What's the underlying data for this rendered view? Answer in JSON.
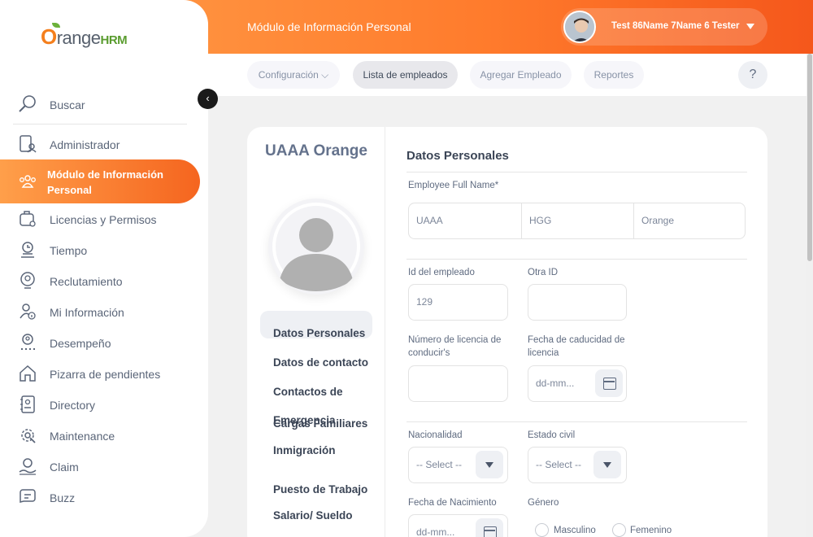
{
  "header": {
    "module_title": "Módulo de Información Personal",
    "user_name": "Test 86Name 7Name 6 Tester"
  },
  "logo": {
    "part1": "O",
    "part2": "range",
    "part3": "HRM"
  },
  "subnav": {
    "items": [
      "Configuración",
      "Lista de empleados",
      "Agregar Empleado",
      "Reportes"
    ],
    "help": "?"
  },
  "sidebar": {
    "items": [
      {
        "label": "Buscar",
        "icon": "search-icon"
      },
      {
        "label": "Administrador",
        "icon": "admin-icon"
      },
      {
        "label": "Módulo de Información Personal",
        "icon": "people-icon"
      },
      {
        "label": "Licencias y Permisos",
        "icon": "leave-icon"
      },
      {
        "label": "Tiempo",
        "icon": "time-icon"
      },
      {
        "label": "Reclutamiento",
        "icon": "recruitment-icon"
      },
      {
        "label": "Mi Información",
        "icon": "my-info-icon"
      },
      {
        "label": "Desempeño",
        "icon": "performance-icon"
      },
      {
        "label": "Pizarra de pendientes",
        "icon": "dashboard-icon"
      },
      {
        "label": "Directory",
        "icon": "directory-icon"
      },
      {
        "label": "Maintenance",
        "icon": "maintenance-icon"
      },
      {
        "label": "Claim",
        "icon": "claim-icon"
      },
      {
        "label": "Buzz",
        "icon": "buzz-icon"
      }
    ],
    "collapse": "‹"
  },
  "employee": {
    "name": "UAAA Orange"
  },
  "tabs": [
    "Datos Personales",
    "Datos de contacto",
    "Contactos de Emergencia",
    "Cargas Familiares",
    "Inmigración",
    "Puesto de Trabajo",
    "Salario/ Sueldo"
  ],
  "form": {
    "section_title": "Datos Personales",
    "full_name_label": "Employee Full Name*",
    "first_name": "UAAA",
    "middle_name": "HGG",
    "last_name": "Orange",
    "emp_id_label": "Id del empleado",
    "emp_id": "129",
    "other_id_label": "Otra ID",
    "other_id": "",
    "license_label": "Número de licencia de conducir's",
    "license_expiry_label": "Fecha de caducidad de licencia",
    "date_placeholder": "dd-mm...",
    "nationality_label": "Nacionalidad",
    "marital_label": "Estado civil",
    "select_placeholder": "-- Select --",
    "dob_label": "Fecha de Nacimiento",
    "gender_label": "Género",
    "gender_male": "Masculino",
    "gender_female": "Femenino"
  },
  "colors": {
    "brand_orange": "#ff7b2c",
    "brand_green": "#5a9c2f"
  }
}
